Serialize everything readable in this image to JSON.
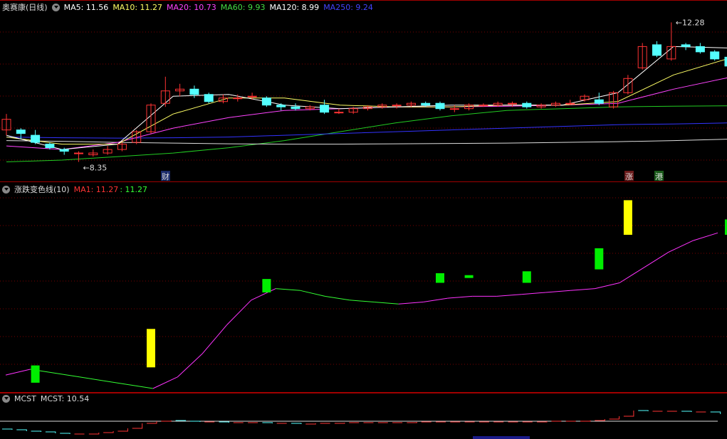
{
  "main": {
    "stock_name": "奥赛康",
    "period": "(日线)",
    "ma": [
      {
        "label": "MA5: ",
        "value": "11.56",
        "color": "#ffffff"
      },
      {
        "label": "MA10: ",
        "value": "11.27",
        "color": "#ffff66"
      },
      {
        "label": "MA20: ",
        "value": "10.73",
        "color": "#ff44ff"
      },
      {
        "label": "MA60: ",
        "value": "9.93",
        "color": "#44dd44"
      },
      {
        "label": "MA120: ",
        "value": "8.99",
        "color": "#ffffff"
      },
      {
        "label": "MA250: ",
        "value": "9.24",
        "color": "#4444ff"
      }
    ],
    "high_marker": "12.28",
    "low_marker": "8.35",
    "tags": {
      "cai": "财",
      "zhang": "涨",
      "gang": "港"
    }
  },
  "indicator": {
    "name": "涨跌变色线(10)",
    "ma1_label": "MA1: 11.27",
    "ma1b_label": ": 11.27"
  },
  "mcst": {
    "name": "MCST",
    "label": "MCST: 10.54"
  },
  "colors": {
    "up": "#ff3333",
    "down": "#54ffff",
    "grid": "#7a0000",
    "border": "#a00000",
    "ma5": "#ffffff",
    "ma10": "#ffff66",
    "ma20": "#ff44ff",
    "ma60": "#22cc22",
    "ma120": "#dddddd",
    "ma250": "#3333ff",
    "sig_green": "#00ee00",
    "sig_yellow": "#ffff00"
  },
  "candles": [
    [
      9.25,
      9.55,
      9.1,
      9.7
    ],
    [
      9.25,
      9.15,
      9.0,
      9.3
    ],
    [
      9.1,
      8.9,
      8.85,
      9.25
    ],
    [
      8.85,
      8.75,
      8.7,
      8.9
    ],
    [
      8.7,
      8.65,
      8.55,
      8.75
    ],
    [
      8.6,
      8.6,
      8.35,
      8.65
    ],
    [
      8.55,
      8.6,
      8.5,
      8.7
    ],
    [
      8.6,
      8.7,
      8.55,
      8.8
    ],
    [
      8.7,
      8.85,
      8.65,
      8.9
    ],
    [
      8.9,
      9.2,
      8.85,
      9.25
    ],
    [
      9.2,
      9.95,
      9.15,
      10.0
    ],
    [
      10.0,
      10.35,
      9.9,
      10.75
    ],
    [
      10.35,
      10.4,
      10.2,
      10.55
    ],
    [
      10.4,
      10.25,
      10.15,
      10.5
    ],
    [
      10.25,
      10.05,
      10.0,
      10.3
    ],
    [
      10.05,
      10.15,
      10.0,
      10.25
    ],
    [
      10.15,
      10.15,
      10.05,
      10.25
    ],
    [
      10.2,
      10.2,
      10.1,
      10.3
    ],
    [
      10.15,
      9.95,
      9.9,
      10.2
    ],
    [
      9.95,
      9.9,
      9.8,
      10.0
    ],
    [
      9.9,
      9.85,
      9.8,
      10.0
    ],
    [
      9.85,
      9.9,
      9.8,
      9.95
    ],
    [
      9.95,
      9.75,
      9.7,
      10.1
    ],
    [
      9.75,
      9.75,
      9.7,
      9.85
    ],
    [
      9.75,
      9.85,
      9.7,
      9.9
    ],
    [
      9.85,
      9.9,
      9.8,
      9.95
    ],
    [
      9.9,
      9.95,
      9.85,
      10.0
    ],
    [
      9.95,
      9.95,
      9.85,
      10.0
    ],
    [
      9.95,
      10.0,
      9.9,
      10.05
    ],
    [
      10.0,
      9.95,
      9.9,
      10.05
    ],
    [
      10.0,
      9.85,
      9.8,
      10.05
    ],
    [
      9.85,
      9.85,
      9.75,
      9.95
    ],
    [
      9.85,
      9.95,
      9.8,
      10.0
    ],
    [
      9.95,
      9.95,
      9.9,
      10.0
    ],
    [
      9.95,
      10.0,
      9.9,
      10.05
    ],
    [
      10.0,
      10.0,
      9.9,
      10.05
    ],
    [
      10.0,
      9.9,
      9.85,
      10.05
    ],
    [
      9.9,
      9.95,
      9.85,
      10.0
    ],
    [
      9.95,
      10.0,
      9.9,
      10.05
    ],
    [
      10.0,
      10.0,
      9.95,
      10.1
    ],
    [
      10.1,
      10.2,
      10.05,
      10.25
    ],
    [
      10.1,
      10.0,
      9.95,
      10.3
    ],
    [
      9.9,
      10.3,
      9.85,
      10.35
    ],
    [
      10.3,
      10.7,
      10.25,
      10.8
    ],
    [
      11.0,
      11.6,
      10.95,
      11.7
    ],
    [
      11.65,
      11.35,
      11.3,
      11.75
    ],
    [
      11.25,
      11.6,
      11.2,
      12.28
    ],
    [
      11.65,
      11.6,
      11.5,
      11.7
    ],
    [
      11.6,
      11.45,
      11.4,
      11.7
    ],
    [
      11.45,
      11.25,
      11.2,
      11.5
    ],
    [
      11.3,
      11.05,
      10.95,
      11.35
    ]
  ],
  "sig_bars": [
    {
      "i": 2,
      "c": "green",
      "y1": 0.12,
      "y2": 0.03
    },
    {
      "i": 10,
      "c": "yellow",
      "y1": 0.31,
      "y2": 0.11
    },
    {
      "i": 18,
      "c": "green",
      "y1": 0.57,
      "y2": 0.5
    },
    {
      "i": 30,
      "c": "green",
      "y1": 0.6,
      "y2": 0.55
    },
    {
      "i": 32,
      "c": "green",
      "y1": 0.59,
      "y2": 0.58
    },
    {
      "i": 36,
      "c": "green",
      "y1": 0.61,
      "y2": 0.55
    },
    {
      "i": 41,
      "c": "green",
      "y1": 0.73,
      "y2": 0.62
    },
    {
      "i": 43,
      "c": "yellow",
      "y1": 0.98,
      "y2": 0.8
    },
    {
      "i": 50,
      "c": "green",
      "y1": 0.88,
      "y2": 0.8
    }
  ]
}
